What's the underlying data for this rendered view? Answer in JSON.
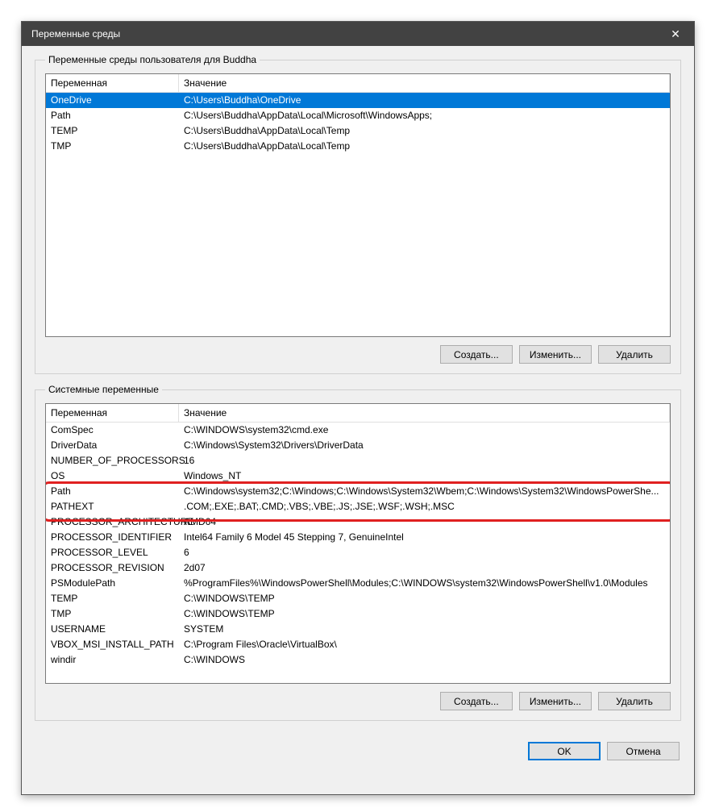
{
  "title": "Переменные среды",
  "user_section": {
    "legend": "Переменные среды пользователя для Buddha",
    "cols": {
      "name": "Переменная",
      "value": "Значение"
    },
    "rows": [
      {
        "name": "OneDrive",
        "value": "C:\\Users\\Buddha\\OneDrive",
        "selected": true
      },
      {
        "name": "Path",
        "value": "C:\\Users\\Buddha\\AppData\\Local\\Microsoft\\WindowsApps;",
        "selected": false
      },
      {
        "name": "TEMP",
        "value": "C:\\Users\\Buddha\\AppData\\Local\\Temp",
        "selected": false
      },
      {
        "name": "TMP",
        "value": "C:\\Users\\Buddha\\AppData\\Local\\Temp",
        "selected": false
      }
    ]
  },
  "system_section": {
    "legend": "Системные переменные",
    "cols": {
      "name": "Переменная",
      "value": "Значение"
    },
    "rows": [
      {
        "name": "ComSpec",
        "value": "C:\\WINDOWS\\system32\\cmd.exe"
      },
      {
        "name": "DriverData",
        "value": "C:\\Windows\\System32\\Drivers\\DriverData"
      },
      {
        "name": "NUMBER_OF_PROCESSORS",
        "value": "16"
      },
      {
        "name": "OS",
        "value": "Windows_NT"
      },
      {
        "name": "Path",
        "value": "C:\\Windows\\system32;C:\\Windows;C:\\Windows\\System32\\Wbem;C:\\Windows\\System32\\WindowsPowerShe..."
      },
      {
        "name": "PATHEXT",
        "value": ".COM;.EXE;.BAT;.CMD;.VBS;.VBE;.JS;.JSE;.WSF;.WSH;.MSC"
      },
      {
        "name": "PROCESSOR_ARCHITECTURE",
        "value": "AMD64"
      },
      {
        "name": "PROCESSOR_IDENTIFIER",
        "value": "Intel64 Family 6 Model 45 Stepping 7, GenuineIntel"
      },
      {
        "name": "PROCESSOR_LEVEL",
        "value": "6"
      },
      {
        "name": "PROCESSOR_REVISION",
        "value": "2d07"
      },
      {
        "name": "PSModulePath",
        "value": "%ProgramFiles%\\WindowsPowerShell\\Modules;C:\\WINDOWS\\system32\\WindowsPowerShell\\v1.0\\Modules"
      },
      {
        "name": "TEMP",
        "value": "C:\\WINDOWS\\TEMP"
      },
      {
        "name": "TMP",
        "value": "C:\\WINDOWS\\TEMP"
      },
      {
        "name": "USERNAME",
        "value": "SYSTEM"
      },
      {
        "name": "VBOX_MSI_INSTALL_PATH",
        "value": "C:\\Program Files\\Oracle\\VirtualBox\\"
      },
      {
        "name": "windir",
        "value": "C:\\WINDOWS"
      }
    ]
  },
  "buttons": {
    "new": "Создать...",
    "edit": "Изменить...",
    "delete": "Удалить",
    "ok": "OK",
    "cancel": "Отмена"
  }
}
